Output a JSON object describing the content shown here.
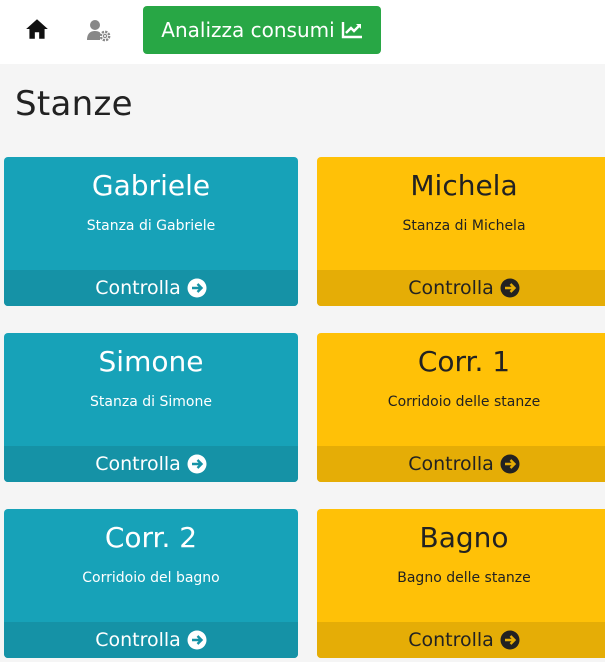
{
  "navbar": {
    "home_icon": "home-icon",
    "settings_icon": "user-cog-icon",
    "analyze_label": "Analizza consumi",
    "analyze_icon": "chart-line-icon",
    "analyze_color": "#28a745"
  },
  "page": {
    "title": "Stanze"
  },
  "colors": {
    "teal": "#17a2b8",
    "teal_footer": "#1592a6",
    "yellow": "#ffc107",
    "yellow_footer": "#e5ad06"
  },
  "rooms": [
    {
      "name": "Gabriele",
      "description": "Stanza di Gabriele",
      "action": "Controlla",
      "color": "teal"
    },
    {
      "name": "Michela",
      "description": "Stanza di Michela",
      "action": "Controlla",
      "color": "yellow"
    },
    {
      "name": "Simone",
      "description": "Stanza di Simone",
      "action": "Controlla",
      "color": "teal"
    },
    {
      "name": "Corr. 1",
      "description": "Corridoio delle stanze",
      "action": "Controlla",
      "color": "yellow"
    },
    {
      "name": "Corr. 2",
      "description": "Corridoio del bagno",
      "action": "Controlla",
      "color": "teal"
    },
    {
      "name": "Bagno",
      "description": "Bagno delle stanze",
      "action": "Controlla",
      "color": "yellow"
    }
  ]
}
